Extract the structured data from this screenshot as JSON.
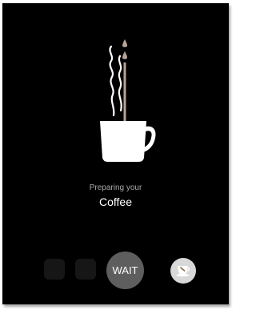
{
  "status": {
    "preparing_label": "Preparing your",
    "product_name": "Coffee"
  },
  "controls": {
    "wait_label": "WAIT"
  },
  "colors": {
    "background": "#000000",
    "cup": "#ffffff",
    "coffee_stream": "#b5a397",
    "wait_button": "#5e5e5e",
    "cup_button": "#d8d8d8"
  },
  "icons": [
    "coffee-cup-icon",
    "steam-icon",
    "coffee-drop-icon",
    "cup-saucer-icon"
  ]
}
